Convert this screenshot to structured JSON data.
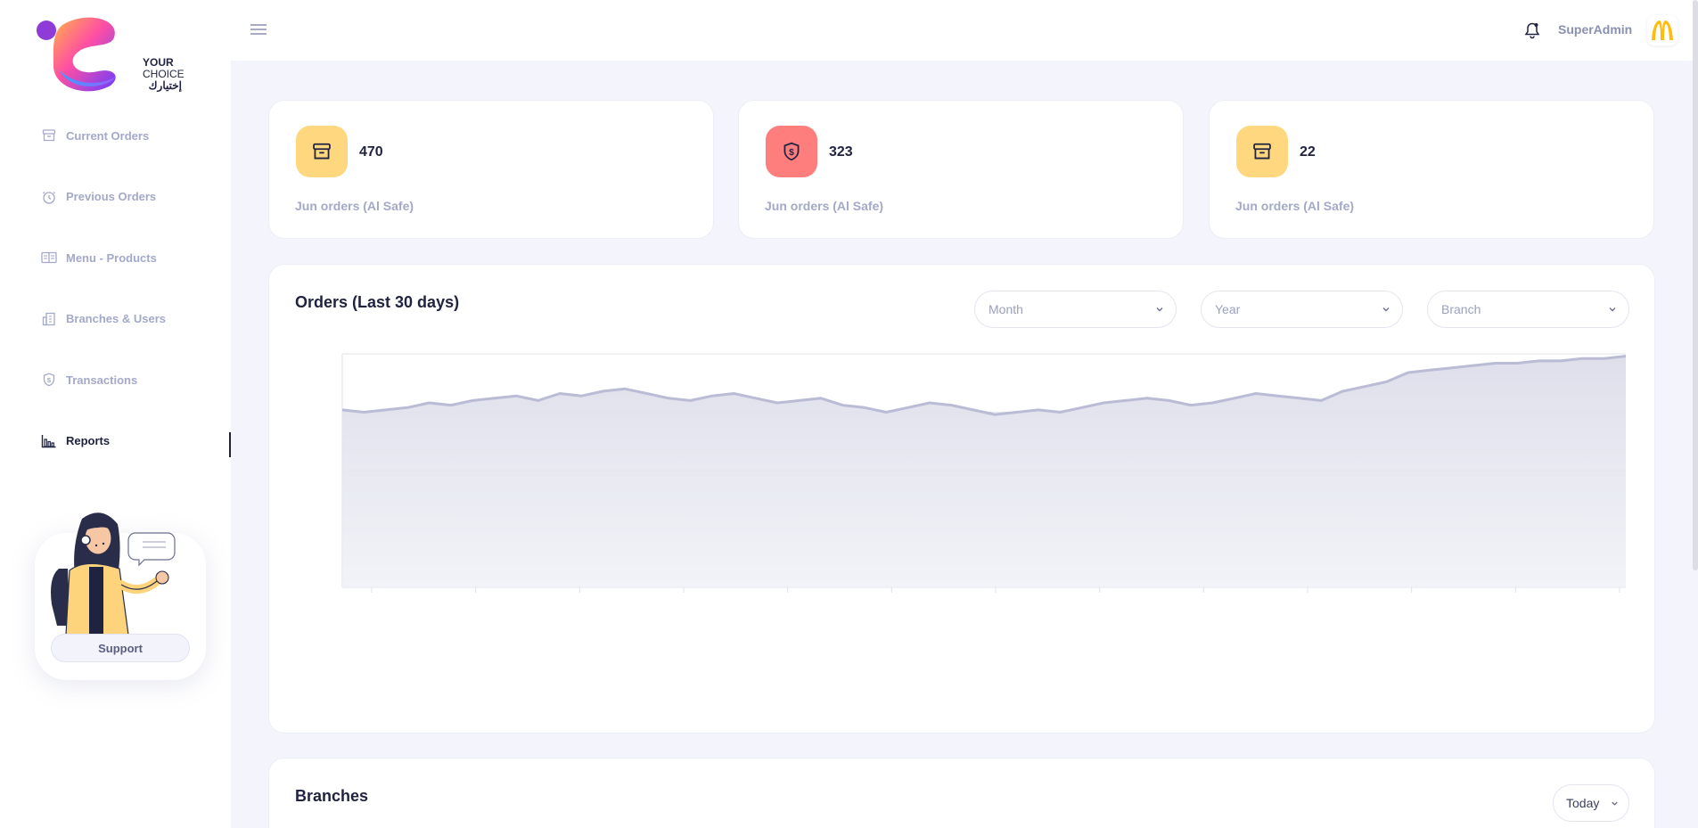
{
  "brand": {
    "name_en_bold": "YOUR",
    "name_en": "CHOICE",
    "name_ar": "إختيارك"
  },
  "sidebar": {
    "items": [
      {
        "label": "Current Orders",
        "icon": "archive-icon",
        "active": false
      },
      {
        "label": "Previous Orders",
        "icon": "clock-icon",
        "active": false
      },
      {
        "label": "Menu - Products",
        "icon": "menu-book-icon",
        "active": false
      },
      {
        "label": "Branches & Users",
        "icon": "building-icon",
        "active": false
      },
      {
        "label": "Transactions",
        "icon": "shield-dollar-icon",
        "active": false
      },
      {
        "label": "Reports",
        "icon": "bar-chart-icon",
        "active": true
      }
    ],
    "support_label": "Support"
  },
  "header": {
    "user": "SuperAdmin",
    "brand_logo": "mcdonalds-logo"
  },
  "stats": [
    {
      "value": "470",
      "label": "Jun orders (Al Safe)",
      "icon": "archive-icon",
      "color": "#fed77e"
    },
    {
      "value": "323",
      "label": "Jun orders (Al Safe)",
      "icon": "shield-dollar-icon",
      "color": "#fe7d7d"
    },
    {
      "value": "22",
      "label": "Jun orders (Al Safe)",
      "icon": "archive-icon",
      "color": "#fed77e"
    }
  ],
  "orders": {
    "title": "Orders (Last 30 days)",
    "filters": {
      "month": "Month",
      "year": "Year",
      "branch": "Branch"
    }
  },
  "branches": {
    "title": "Branches",
    "period": "Today"
  },
  "colors": {
    "accent_yellow": "#fed77e",
    "accent_red": "#fe7d7d",
    "line": "#b9bcd4",
    "fill": "#e4e5ef"
  },
  "chart_data": {
    "type": "area",
    "title": "",
    "xlabel": "",
    "ylabel": "",
    "ylim": [
      0,
      100
    ],
    "grid": true,
    "legend": "none",
    "series": [
      {
        "values": [
          76,
          75,
          76,
          77,
          79,
          78,
          80,
          81,
          82,
          80,
          83,
          82,
          84,
          85,
          83,
          81,
          80,
          82,
          83,
          81,
          79,
          80,
          81,
          78,
          77,
          75,
          77,
          79,
          78,
          76,
          74,
          75,
          76,
          75,
          77,
          79,
          80,
          81,
          80,
          78,
          79,
          81,
          83,
          82,
          81,
          80,
          84,
          86,
          88,
          92,
          93,
          94,
          95,
          96,
          96,
          97,
          97,
          98,
          98,
          99
        ]
      }
    ]
  }
}
